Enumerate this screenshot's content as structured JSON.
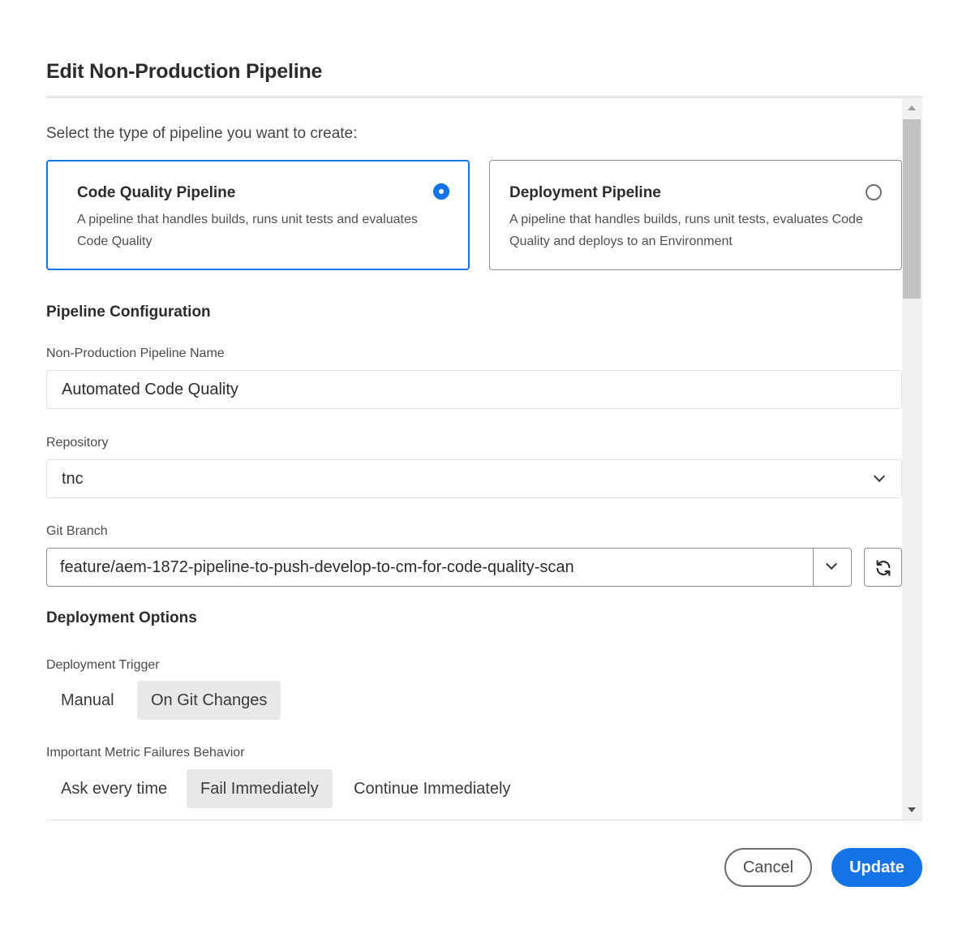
{
  "dialog": {
    "title": "Edit Non-Production Pipeline"
  },
  "pipeline_type": {
    "prompt": "Select the type of pipeline you want to create:",
    "options": [
      {
        "title": "Code Quality Pipeline",
        "description": "A pipeline that handles builds, runs unit tests and evaluates Code Quality",
        "selected": true
      },
      {
        "title": "Deployment Pipeline",
        "description": "A pipeline that handles builds, runs unit tests, evaluates Code Quality and deploys to an Environment",
        "selected": false
      }
    ]
  },
  "configuration": {
    "heading": "Pipeline Configuration",
    "name_label": "Non-Production Pipeline Name",
    "name_value": "Automated Code Quality",
    "repository_label": "Repository",
    "repository_value": "tnc",
    "branch_label": "Git Branch",
    "branch_value": "feature/aem-1872-pipeline-to-push-develop-to-cm-for-code-quality-scan"
  },
  "deployment_options": {
    "heading": "Deployment Options",
    "trigger_label": "Deployment Trigger",
    "trigger_options": [
      "Manual",
      "On Git Changes"
    ],
    "trigger_selected": "On Git Changes",
    "failure_label": "Important Metric Failures Behavior",
    "failure_options": [
      "Ask every time",
      "Fail Immediately",
      "Continue Immediately"
    ],
    "failure_selected": "Fail Immediately"
  },
  "footer": {
    "cancel_label": "Cancel",
    "update_label": "Update"
  },
  "icons": {
    "radio_selected": "radio-selected-icon",
    "radio_unselected": "radio-unselected-icon",
    "dropdown": "chevron-down-icon",
    "refresh": "refresh-icon",
    "scroll_up": "scroll-up-arrow-icon",
    "scroll_down": "scroll-down-arrow-icon"
  },
  "colors": {
    "accent": "#1473e6",
    "selected_segment": "#e8e8e8",
    "text": "#2c2c2c"
  }
}
